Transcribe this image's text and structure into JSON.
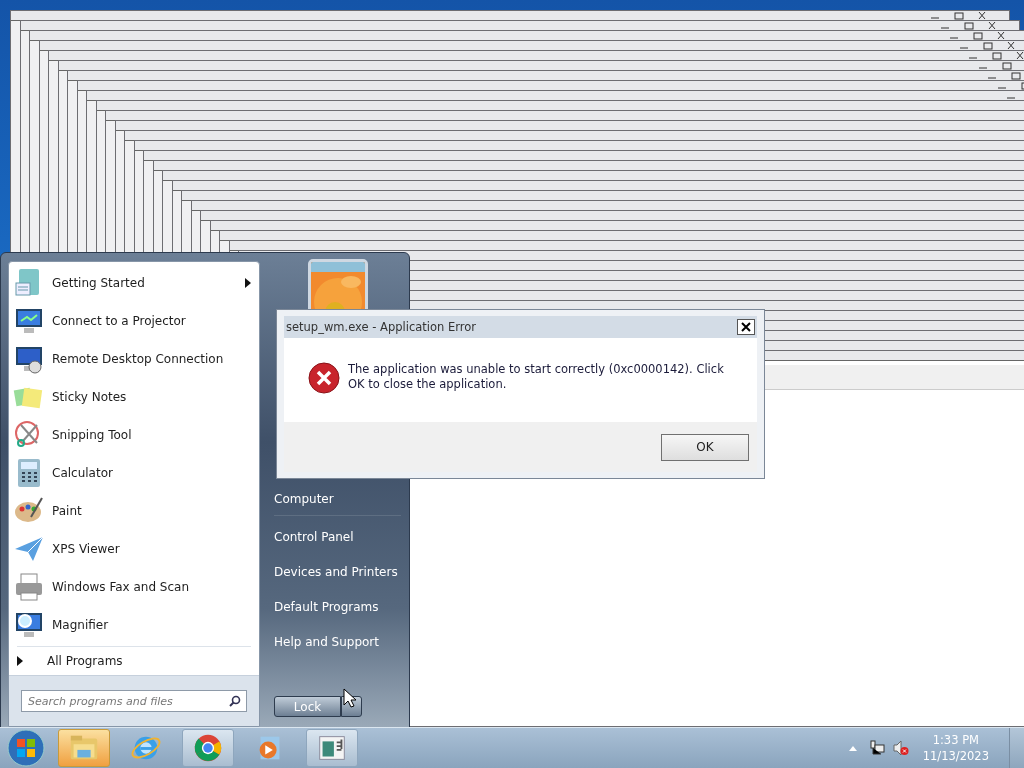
{
  "error_dialog": {
    "title": "setup_wm.exe - Application Error",
    "message": "The application was unable to start correctly (0xc0000142). Click OK to close the application.",
    "button": "OK"
  },
  "start_menu": {
    "programs": [
      {
        "label": "Getting Started",
        "has_submenu": true
      },
      {
        "label": "Connect to a Projector",
        "has_submenu": false
      },
      {
        "label": "Remote Desktop Connection",
        "has_submenu": false
      },
      {
        "label": "Sticky Notes",
        "has_submenu": false
      },
      {
        "label": "Snipping Tool",
        "has_submenu": false
      },
      {
        "label": "Calculator",
        "has_submenu": false
      },
      {
        "label": "Paint",
        "has_submenu": false
      },
      {
        "label": "XPS Viewer",
        "has_submenu": false
      },
      {
        "label": "Windows Fax and Scan",
        "has_submenu": false
      },
      {
        "label": "Magnifier",
        "has_submenu": false
      }
    ],
    "all_programs": "All Programs",
    "search": {
      "placeholder": "Search programs and files"
    },
    "places": [
      "Computer",
      "Control Panel",
      "Devices and Printers",
      "Default Programs",
      "Help and Support"
    ],
    "shutdown_button": "Lock"
  },
  "taskbar": {
    "buttons": [
      {
        "selected": true,
        "running": true
      },
      {
        "selected": false,
        "running": false
      },
      {
        "selected": false,
        "running": true
      },
      {
        "selected": false,
        "running": false
      },
      {
        "selected": false,
        "running": true
      }
    ],
    "clock": {
      "time": "1:33 PM",
      "date": "11/13/2023"
    }
  }
}
